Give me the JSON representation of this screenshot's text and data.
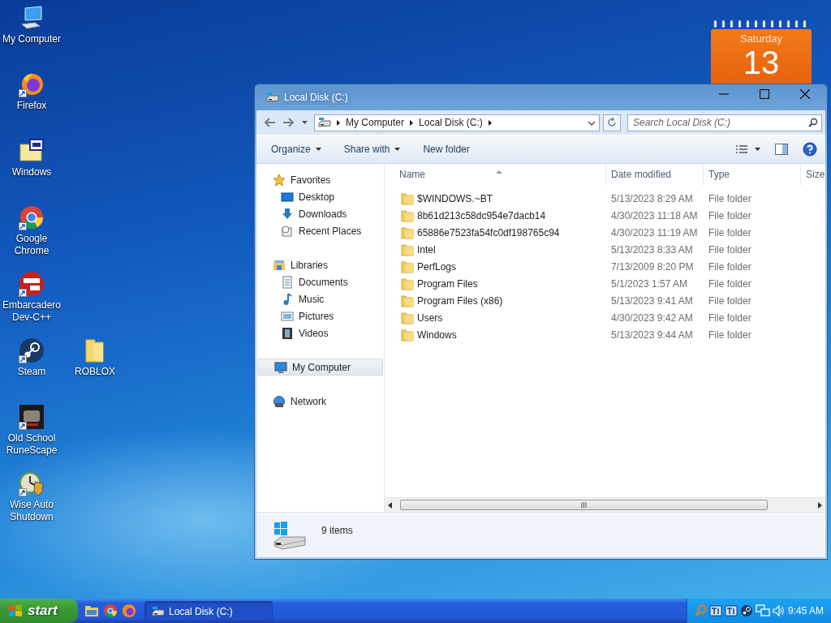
{
  "desktop": {
    "icons": [
      {
        "label": "My Computer",
        "kind": "computer",
        "shortcut": false
      },
      {
        "label": "Firefox",
        "kind": "firefox",
        "shortcut": true
      },
      {
        "label": "Windows",
        "kind": "iso",
        "shortcut": false
      },
      {
        "label": "Google Chrome",
        "kind": "chrome",
        "shortcut": true
      },
      {
        "label": "Embarcadero Dev-C++",
        "kind": "devcpp",
        "shortcut": true
      },
      {
        "label": "Steam",
        "kind": "steam",
        "shortcut": true
      },
      {
        "label": "ROBLOX",
        "kind": "folder",
        "shortcut": false
      },
      {
        "label": "Old School RuneScape",
        "kind": "runescape",
        "shortcut": true
      },
      {
        "label": "Wise Auto Shutdown",
        "kind": "wise",
        "shortcut": true
      }
    ],
    "gadget": {
      "weekday": "Saturday",
      "day": "13"
    }
  },
  "window": {
    "title": "Local Disk (C:)",
    "breadcrumb": [
      "My Computer",
      "Local Disk (C:)"
    ],
    "search": {
      "placeholder": "Search Local Disk (C:)"
    },
    "toolbar": [
      {
        "label": "Organize",
        "dropdown": true
      },
      {
        "label": "Share with",
        "dropdown": true
      },
      {
        "label": "New folder",
        "dropdown": false
      }
    ],
    "navigation": [
      {
        "label": "Favorites",
        "kind": "star",
        "selected": false,
        "children": [
          {
            "label": "Desktop",
            "kind": "desktop",
            "selected": false
          },
          {
            "label": "Downloads",
            "kind": "download",
            "selected": false
          },
          {
            "label": "Recent Places",
            "kind": "recent",
            "selected": false
          }
        ]
      },
      {
        "label": "Libraries",
        "kind": "library",
        "selected": false,
        "children": [
          {
            "label": "Documents",
            "kind": "document",
            "selected": false
          },
          {
            "label": "Music",
            "kind": "music",
            "selected": false
          },
          {
            "label": "Pictures",
            "kind": "picture",
            "selected": false
          },
          {
            "label": "Videos",
            "kind": "video",
            "selected": false
          }
        ]
      },
      {
        "label": "My Computer",
        "kind": "computer",
        "selected": true
      },
      {
        "label": "Network",
        "kind": "network",
        "selected": false
      }
    ],
    "columns": [
      "Name",
      "Date modified",
      "Type",
      "Size"
    ],
    "rows": [
      {
        "name": "$WINDOWS.~BT",
        "date": "5/13/2023 8:29 AM",
        "type": "File folder"
      },
      {
        "name": "8b61d213c58dc954e7dacb14",
        "date": "4/30/2023 11:18 AM",
        "type": "File folder"
      },
      {
        "name": "65886e7523fa54fc0df198765c94",
        "date": "4/30/2023 11:19 AM",
        "type": "File folder"
      },
      {
        "name": "Intel",
        "date": "5/13/2023 8:33 AM",
        "type": "File folder"
      },
      {
        "name": "PerfLogs",
        "date": "7/13/2009 8:20 PM",
        "type": "File folder"
      },
      {
        "name": "Program Files",
        "date": "5/1/2023 1:57 AM",
        "type": "File folder"
      },
      {
        "name": "Program Files (x86)",
        "date": "5/13/2023 9:41 AM",
        "type": "File folder"
      },
      {
        "name": "Users",
        "date": "4/30/2023 9:42 AM",
        "type": "File folder"
      },
      {
        "name": "Windows",
        "date": "5/13/2023 9:44 AM",
        "type": "File folder"
      }
    ],
    "status": "9 items"
  },
  "taskbar": {
    "start": "start",
    "tasks": [
      {
        "label": "Local Disk (C:)"
      }
    ],
    "clock": "9:45 AM"
  }
}
